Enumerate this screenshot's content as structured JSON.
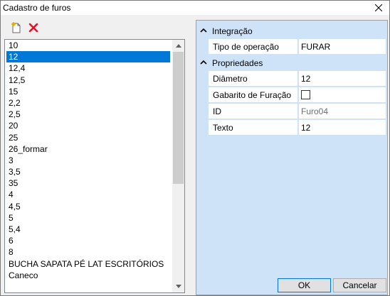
{
  "window": {
    "title": "Cadastro de furos"
  },
  "toolbar": {
    "new_icon": "new-document-icon",
    "delete_icon": "delete-x-icon"
  },
  "list": {
    "items": [
      {
        "label": "10",
        "selected": false
      },
      {
        "label": "12",
        "selected": true
      },
      {
        "label": "12,4",
        "selected": false
      },
      {
        "label": "12,5",
        "selected": false
      },
      {
        "label": "15",
        "selected": false
      },
      {
        "label": "2,2",
        "selected": false
      },
      {
        "label": "2,5",
        "selected": false
      },
      {
        "label": "20",
        "selected": false
      },
      {
        "label": "25",
        "selected": false
      },
      {
        "label": "26_formar",
        "selected": false
      },
      {
        "label": "3",
        "selected": false
      },
      {
        "label": "3,5",
        "selected": false
      },
      {
        "label": "35",
        "selected": false
      },
      {
        "label": "4",
        "selected": false
      },
      {
        "label": "4,5",
        "selected": false
      },
      {
        "label": "5",
        "selected": false
      },
      {
        "label": "5,4",
        "selected": false
      },
      {
        "label": "6",
        "selected": false
      },
      {
        "label": "8",
        "selected": false
      },
      {
        "label": "BUCHA SAPATA PÉ LAT ESCRITÓRIOS",
        "selected": false
      },
      {
        "label": "Caneco",
        "selected": false
      }
    ]
  },
  "propgrid": {
    "categories": [
      {
        "label": "Integração",
        "rows": [
          {
            "name": "Tipo de operação",
            "value": "FURAR"
          }
        ]
      },
      {
        "label": "Propriedades",
        "rows": [
          {
            "name": "Diâmetro",
            "value": "12"
          },
          {
            "name": "Gabarito de Furação",
            "value": "",
            "checkbox": true,
            "checked": false
          },
          {
            "name": "ID",
            "value": "Furo04",
            "readonly": true
          },
          {
            "name": "Texto",
            "value": "12"
          }
        ]
      }
    ]
  },
  "buttons": {
    "ok": "OK",
    "cancel": "Cancelar"
  },
  "colors": {
    "selection": "#0078d7",
    "grid_bg": "#cfe3f8",
    "delete": "#e81123"
  }
}
